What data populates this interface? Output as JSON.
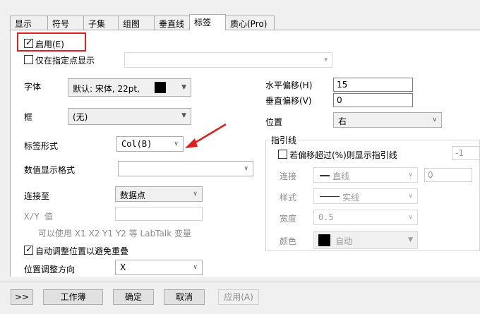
{
  "tabs": [
    "显示",
    "符号",
    "子集",
    "组图",
    "垂直线",
    "标签",
    "质心(Pro)"
  ],
  "active_tab": "标签",
  "enable": {
    "label": "启用(E)",
    "checked": true
  },
  "only_points": {
    "label": "仅在指定点显示",
    "checked": false
  },
  "font": {
    "label": "字体",
    "value": "默认: 宋体, 22pt,",
    "color": "#000000"
  },
  "frame": {
    "label": "框",
    "value": "(无)"
  },
  "label_form": {
    "label": "标签形式",
    "value": "Col(B)"
  },
  "numeric_format": {
    "label": "数值显示格式",
    "value": ""
  },
  "connect_to": {
    "label": "连接至",
    "value": "数据点"
  },
  "xy_value": {
    "label": "X/Y 值",
    "value": ""
  },
  "hint": "可以使用 X1 X2 Y1 Y2 等 LabTalk 变量",
  "auto_adjust": {
    "label": "自动调整位置以避免重叠",
    "checked": true
  },
  "adjust_direction": {
    "label": "位置调整方向",
    "value": "X"
  },
  "h_offset": {
    "label": "水平偏移(H)",
    "value": "15"
  },
  "v_offset": {
    "label": "垂直偏移(V)",
    "value": "0"
  },
  "position": {
    "label": "位置",
    "value": "右"
  },
  "leader": {
    "title": "指引线",
    "show_if": {
      "label": "若偏移超过(%)则显示指引线",
      "checked": false,
      "value": "-1"
    },
    "connect": {
      "label": "连接",
      "value": "直线",
      "number": "0"
    },
    "style": {
      "label": "样式",
      "value": "实线"
    },
    "width": {
      "label": "宽度",
      "value": "0.5"
    },
    "color": {
      "label": "颜色",
      "value": "自动"
    }
  },
  "footer": {
    "expand": ">>",
    "workbook": "工作薄",
    "ok": "确定",
    "cancel": "取消",
    "apply": "应用(A)"
  },
  "colors": {
    "highlight": "#e02020",
    "arrow": "#e02020"
  }
}
